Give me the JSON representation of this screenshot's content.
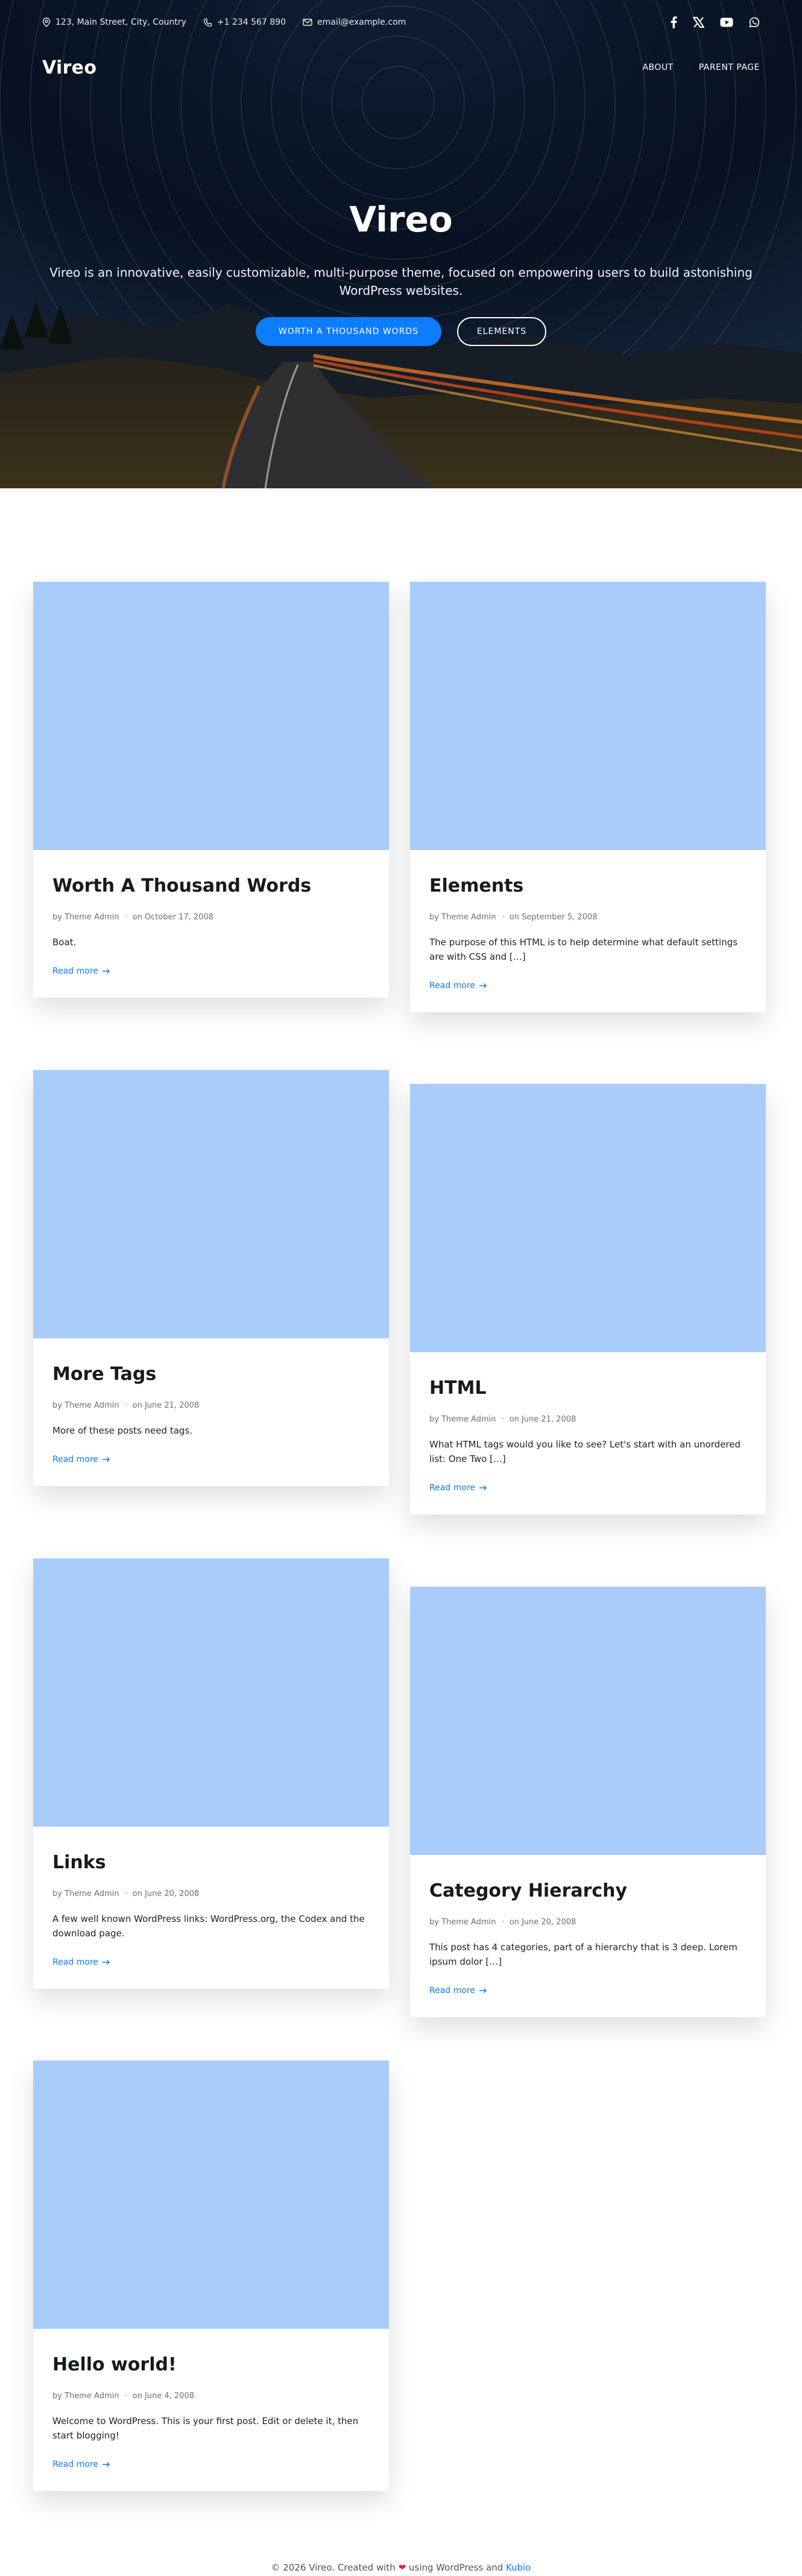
{
  "topbar": {
    "address": "123, Main Street, City, Country",
    "phone": "+1 234 567 890",
    "email": "email@example.com",
    "socials": [
      "facebook-icon",
      "x-icon",
      "youtube-icon",
      "whatsapp-icon"
    ]
  },
  "header": {
    "logo": "Vireo",
    "nav": [
      "ABOUT",
      "PARENT PAGE"
    ]
  },
  "hero": {
    "title": "Vireo",
    "subtitle": "Vireo is an innovative, easily customizable, multi-purpose theme, focused on empowering users to build astonishing WordPress websites.",
    "primary_button": "WORTH A THOUSAND WORDS",
    "secondary_button": "ELEMENTS"
  },
  "posts": [
    {
      "title": "Worth A Thousand Words",
      "author": "by Theme Admin",
      "date": "on October 17, 2008",
      "excerpt": "Boat.",
      "read_more": "Read more"
    },
    {
      "title": "Elements",
      "author": "by Theme Admin",
      "date": "on September 5, 2008",
      "excerpt": "The purpose of this HTML is to help determine what default settings are with CSS and […]",
      "read_more": "Read more"
    },
    {
      "title": "More Tags",
      "author": "by Theme Admin",
      "date": "on June 21, 2008",
      "excerpt": "More of these posts need tags.",
      "read_more": "Read more"
    },
    {
      "title": "HTML",
      "author": "by Theme Admin",
      "date": "on June 21, 2008",
      "excerpt": "What HTML tags would you like to see? Let's start with an unordered list: One Two […]",
      "read_more": "Read more"
    },
    {
      "title": "Links",
      "author": "by Theme Admin",
      "date": "on June 20, 2008",
      "excerpt": "A few well known WordPress links: WordPress.org, the Codex and the download page.",
      "read_more": "Read more"
    },
    {
      "title": "Category Hierarchy",
      "author": "by Theme Admin",
      "date": "on June 20, 2008",
      "excerpt": "This post has 4 categories, part of a hierarchy that is 3 deep. Lorem ipsum dolor […]",
      "read_more": "Read more"
    },
    {
      "title": "Hello world!",
      "author": "by Theme Admin",
      "date": "on June 4, 2008",
      "excerpt": "Welcome to WordPress. This is your first post. Edit or delete it, then start blogging!",
      "read_more": "Read more"
    }
  ],
  "footer": {
    "prefix": "© 2026 Vireo. Created with",
    "middle": "using WordPress and",
    "link": "Kubio"
  },
  "colors": {
    "accent": "#0d7cff",
    "thumb_placeholder": "#a9ccfb",
    "heart": "#e0243a"
  }
}
